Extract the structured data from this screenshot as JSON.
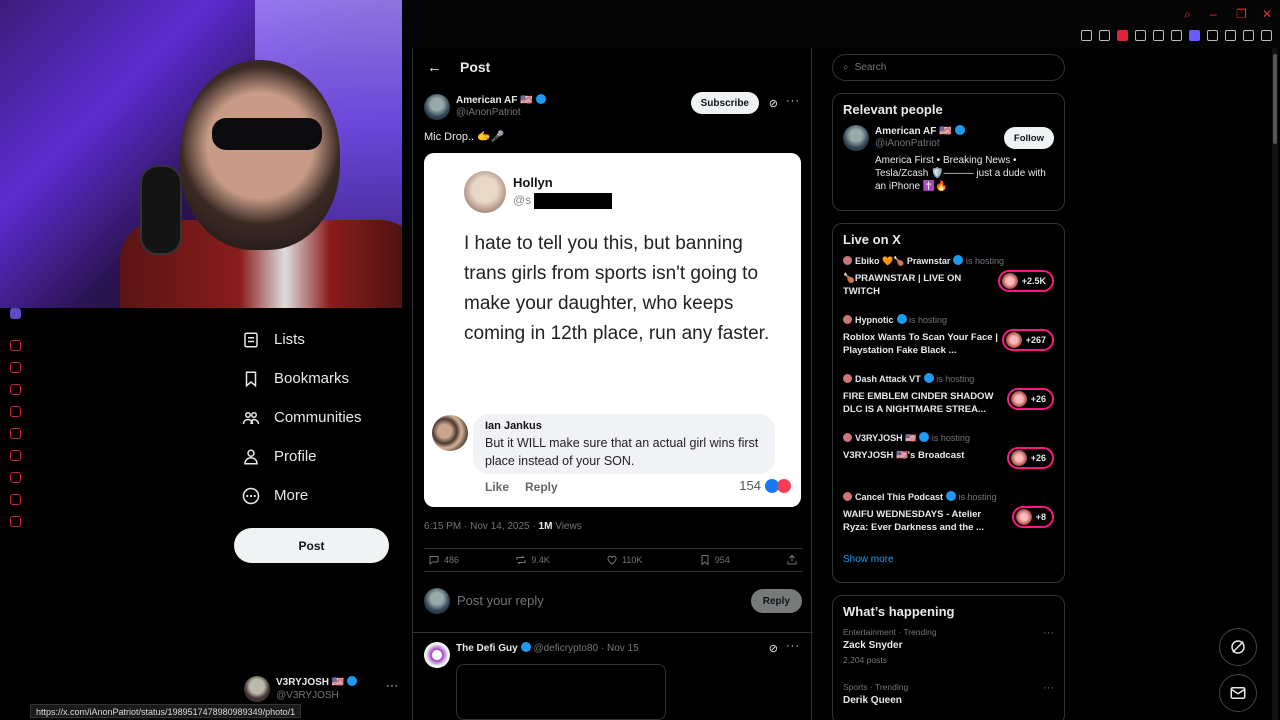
{
  "post_header": {
    "title": "Post",
    "back": "←"
  },
  "author": {
    "name": "American AF 🇺🇸",
    "handle": "@iAnonPatriot",
    "subscribe": "Subscribe"
  },
  "post": {
    "text": "Mic Drop.. 🫱🎤",
    "embedded": {
      "name": "Hollyn",
      "handle": "@s",
      "body": "I hate to tell you this, but banning trans girls from sports isn't going to make your daughter, who keeps coming in 12th place, run any faster.",
      "reply_name": "Ian Jankus",
      "reply_text": "But it WILL make sure that an actual girl wins first place instead of your SON.",
      "like": "Like",
      "reply": "Reply",
      "reactions": "154"
    },
    "meta": {
      "time": "6:15 PM · Nov 14, 2025 · ",
      "views_count": "1M",
      "views_label": " Views"
    },
    "stats": {
      "replies": "486",
      "reposts": "9.4K",
      "likes": "110K",
      "bookmarks": "954"
    }
  },
  "compose": {
    "placeholder": "Post your reply",
    "button": "Reply"
  },
  "reply2": {
    "name": "The Defi Guy",
    "handle": "@deficrypto80 · Nov 15"
  },
  "nav": {
    "lists": "Lists",
    "bookmarks": "Bookmarks",
    "communities": "Communities",
    "profile": "Profile",
    "more": "More",
    "post": "Post"
  },
  "me": {
    "name": "V3RYJOSH 🇺🇸",
    "handle": "@V3RYJOSH"
  },
  "search": {
    "placeholder": "Search"
  },
  "relevant": {
    "title": "Relevant people",
    "name": "American AF 🇺🇸",
    "handle": "@iAnonPatriot",
    "bio": "America First • Breaking News • Tesla/Zcash 🛡️——— just a dude with an iPhone ✝️🔥",
    "follow": "Follow"
  },
  "live": {
    "title": "Live on X",
    "hosting": "is hosting",
    "items": [
      {
        "host": "Ebiko 🧡🍗 Prawnstar",
        "title": "🍗PRAWNSTAR | LIVE ON TWITCH",
        "count": "+2.5K"
      },
      {
        "host": "Hypnotic",
        "title": "Roblox Wants To Scan Your Face | Playstation Fake Black ...",
        "count": "+267"
      },
      {
        "host": "Dash Attack VT",
        "title": "FIRE EMBLEM CINDER SHADOW DLC IS A NIGHTMARE STREA...",
        "count": "+26"
      },
      {
        "host": "V3RYJOSH 🇺🇸",
        "title": "V3RYJOSH 🇺🇸's Broadcast",
        "count": "+26"
      },
      {
        "host": "Cancel This Podcast",
        "title": "WAIFU WEDNESDAYS - Atelier Ryza: Ever Darkness and the ...",
        "count": "+8"
      }
    ],
    "show_more": "Show more"
  },
  "happening": {
    "title": "What’s happening",
    "trends": [
      {
        "category": "Entertainment · Trending",
        "topic": "Zack Snyder",
        "posts": "2,204 posts"
      },
      {
        "category": "Sports · Trending",
        "topic": "Derik Queen",
        "posts": ""
      }
    ]
  },
  "status_url": "https://x.com/iAnonPatriot/status/1989517478980989349/photo/1",
  "colors": {
    "accent": "#1d9bf0",
    "live": "#f91880",
    "browser_red": "#d0243a"
  }
}
